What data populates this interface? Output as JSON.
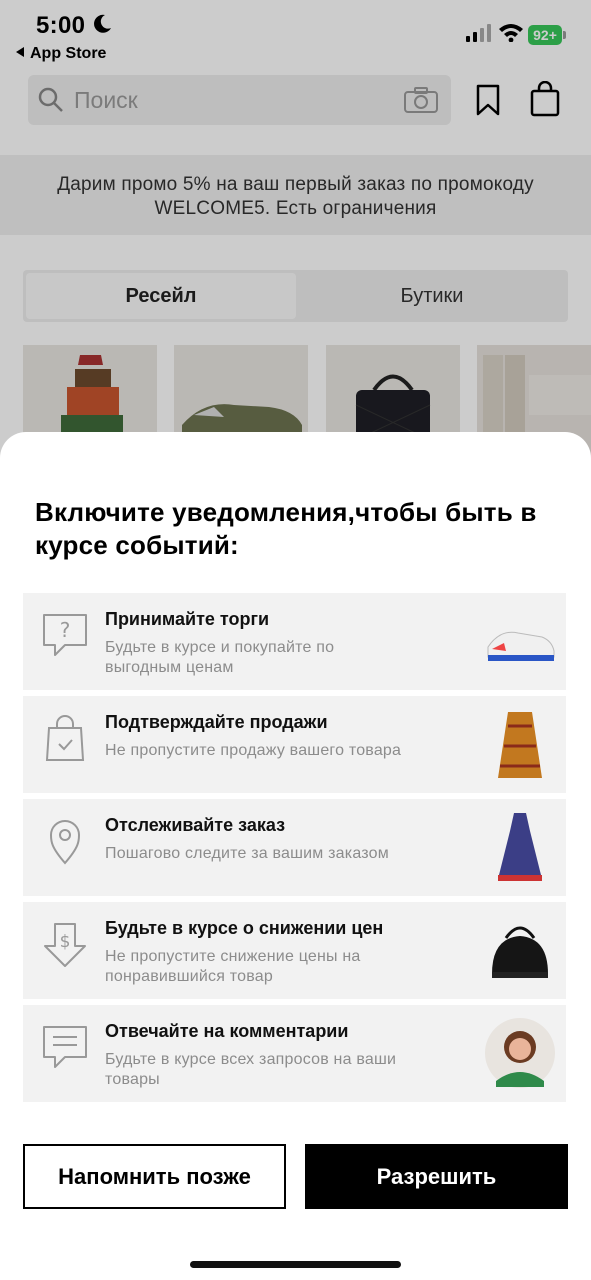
{
  "status_bar": {
    "time": "5:00",
    "back_app": "App Store",
    "battery": "92+"
  },
  "header": {
    "search_placeholder": "Поиск",
    "icons": [
      "search-icon",
      "camera-icon",
      "bookmark-icon",
      "bag-icon"
    ]
  },
  "promo": {
    "line1": "Дарим промо 5% на ваш первый заказ по промокоду",
    "line2": "WELCOME5. Есть ограничения"
  },
  "tabs": [
    {
      "label": "Ресейл",
      "active": true
    },
    {
      "label": "Бутики",
      "active": false
    }
  ],
  "sheet": {
    "title": "Включите уведомления,чтобы быть в курсе событий:",
    "items": [
      {
        "title": "Принимайте торги",
        "desc": "Будьте в курсе и покупайте по выгодным ценам",
        "icon": "question-bubble-icon"
      },
      {
        "title": "Подтверждайте продажи",
        "desc": "Не пропустите продажу вашего товара",
        "icon": "shopping-bag-check-icon"
      },
      {
        "title": "Отслеживайте заказ",
        "desc": "Пошагово следите за вашим заказом",
        "icon": "location-pin-icon"
      },
      {
        "title": "Будьте в курсе о снижении цен",
        "desc": "Не пропустите снижение цены на понравившийся товар",
        "icon": "price-drop-icon"
      },
      {
        "title": "Отвечайте на комментарии",
        "desc": "Будьте в курсе всех запросов на ваши товары",
        "icon": "comment-bubble-icon"
      }
    ],
    "later_label": "Напомнить позже",
    "allow_label": "Разрешить"
  },
  "colors": {
    "battery": "#37c759",
    "card_bg": "#f2f2f2",
    "primary_button": "#000000"
  }
}
